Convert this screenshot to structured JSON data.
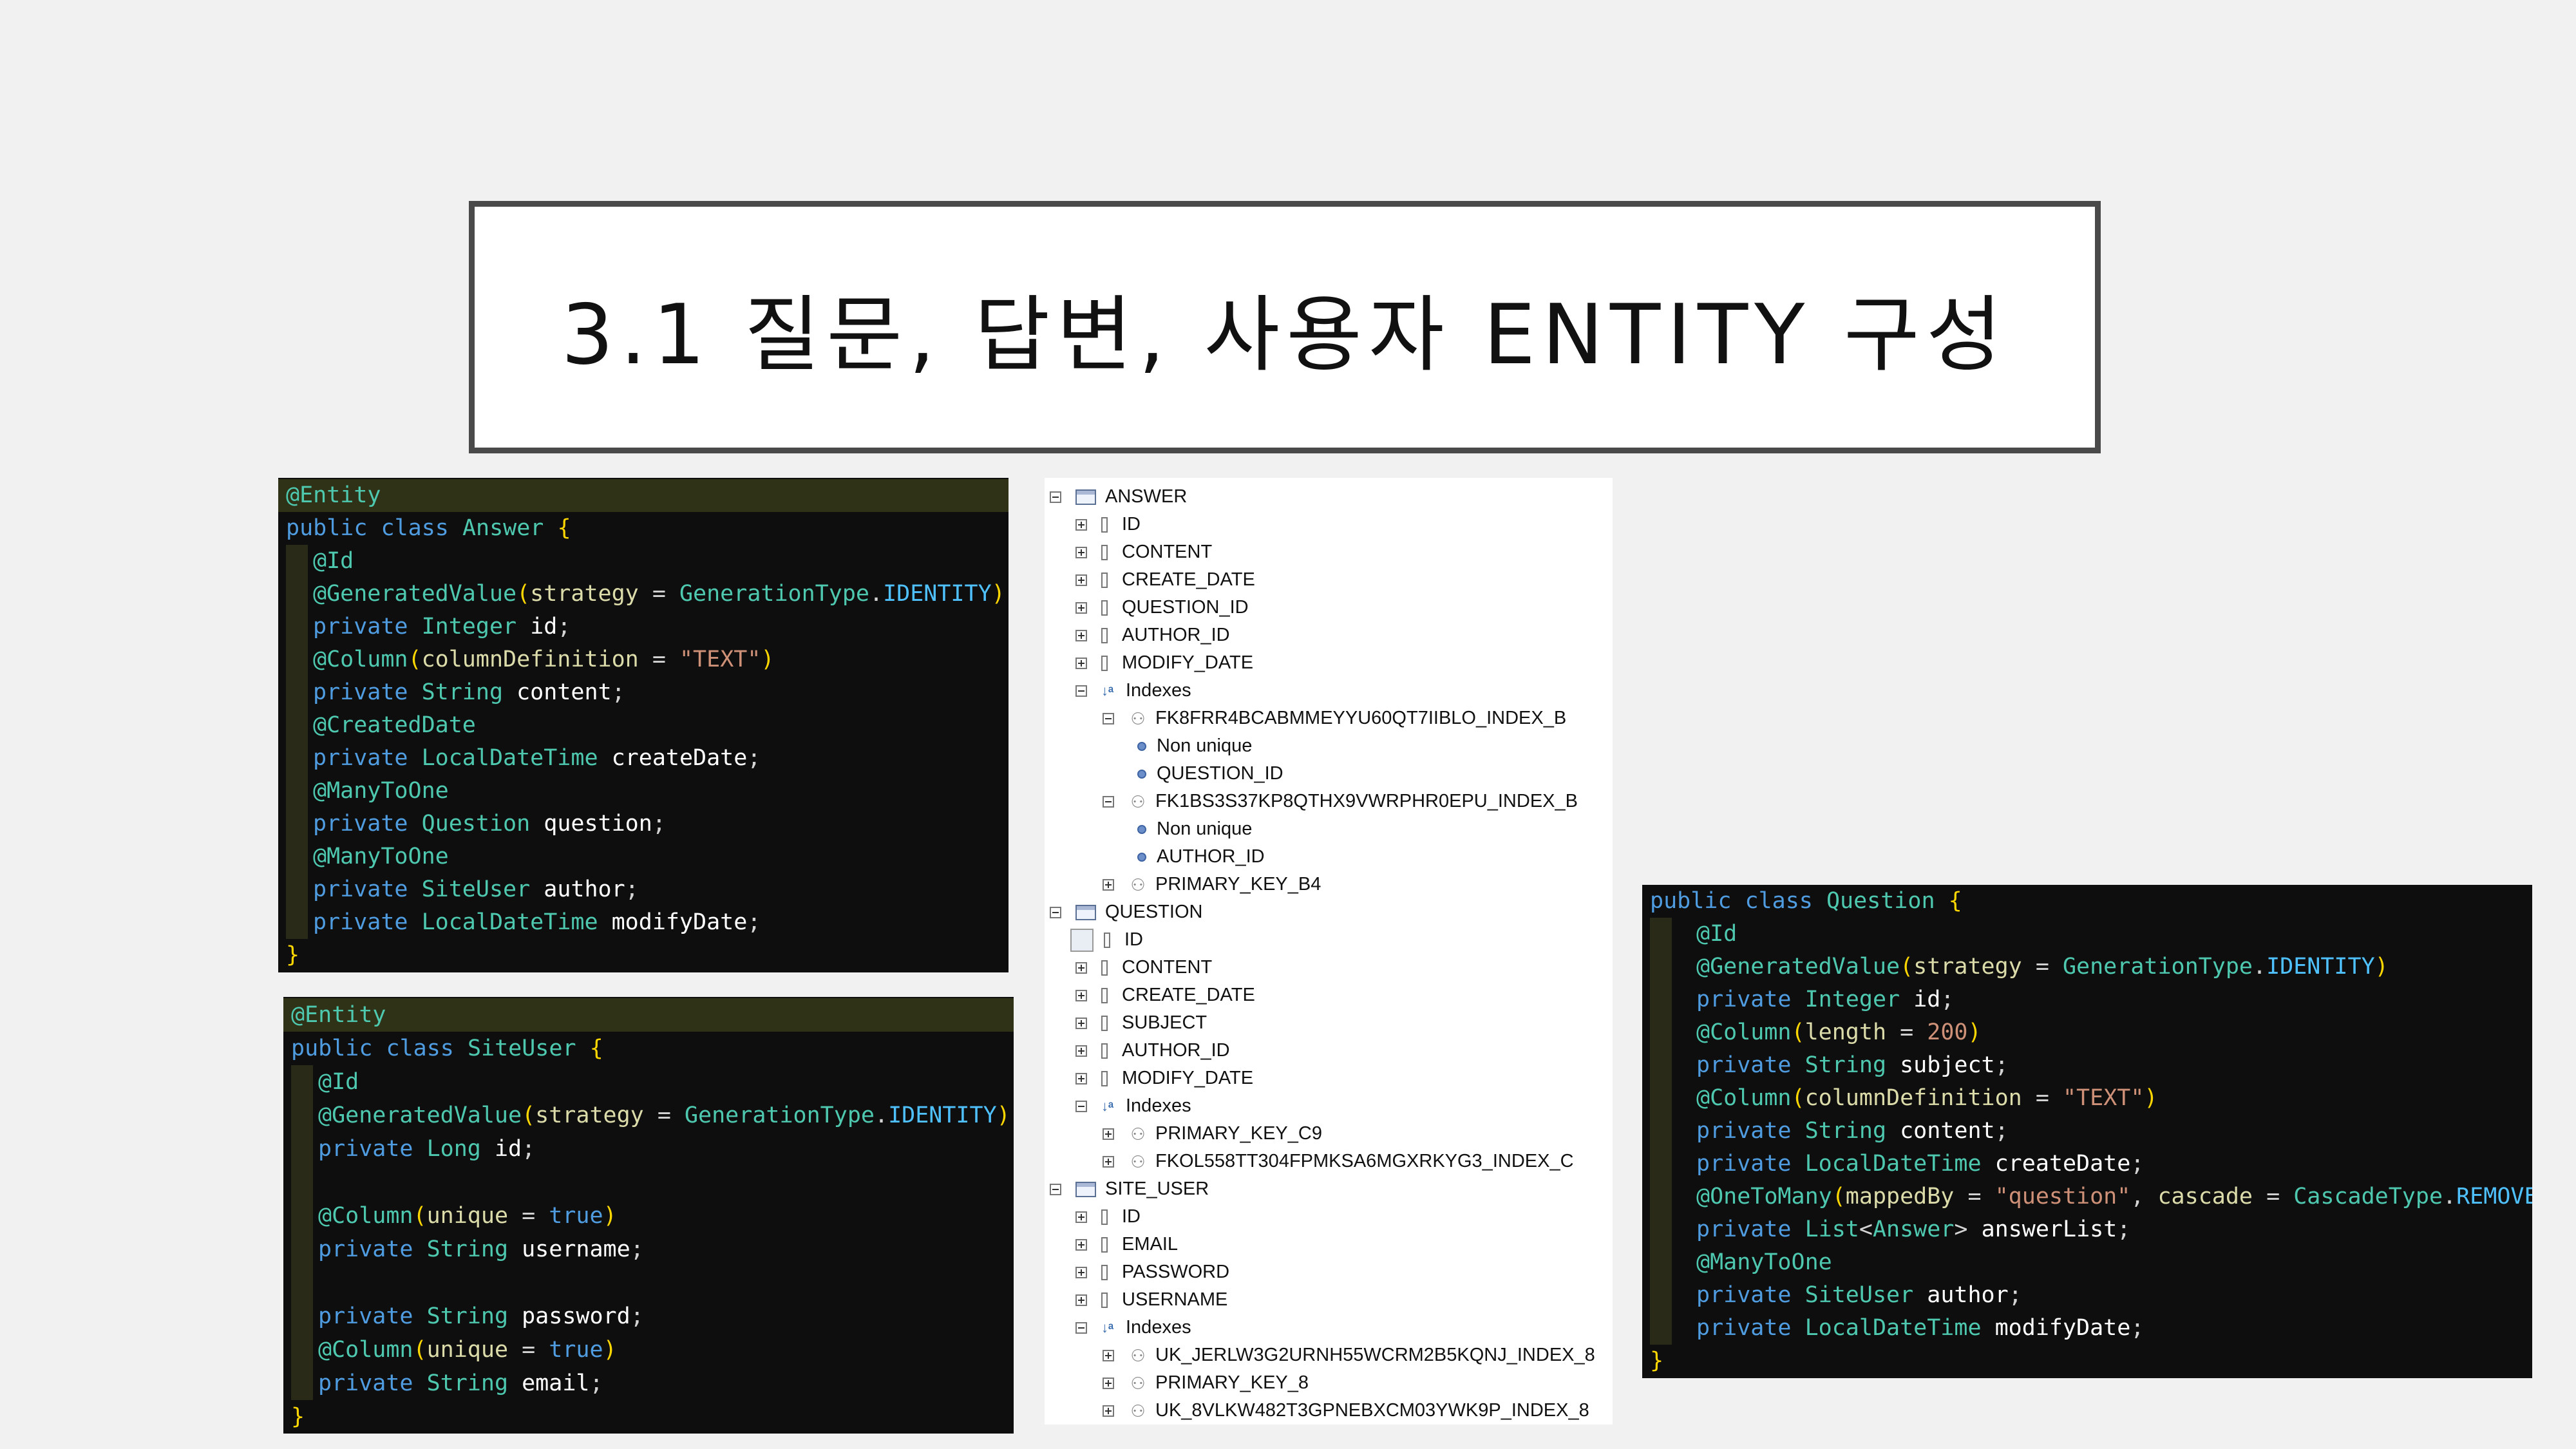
{
  "slide": {
    "title": "3.1 질문, 답변, 사용자 ENTITY 구성"
  },
  "answer_code": {
    "l1": "@Entity",
    "l2_kw": "public class",
    "l2_cls": "Answer",
    "l3": "@Id",
    "l4_ann": "@GeneratedValue",
    "l4_arg": "strategy",
    "l4_type": "GenerationType",
    "l4_const": "IDENTITY",
    "l5_kw": "private",
    "l5_type": "Integer",
    "l5_var": "id",
    "l6_ann": "@Column",
    "l6_arg": "columnDefinition",
    "l6_str": "\"TEXT\"",
    "l7_type": "String",
    "l7_var": "content",
    "l8": "@CreatedDate",
    "l9_type": "LocalDateTime",
    "l9_var": "createDate",
    "l10": "@ManyToOne",
    "l11_type": "Question",
    "l11_var": "question",
    "l12": "@ManyToOne",
    "l13_type": "SiteUser",
    "l13_var": "author",
    "l14_type": "LocalDateTime",
    "l14_var": "modifyDate"
  },
  "siteuser_code": {
    "l1": "@Entity",
    "l2_kw": "public class",
    "l2_cls": "SiteUser",
    "l3": "@Id",
    "l4_ann": "@GeneratedValue",
    "l4_arg": "strategy",
    "l4_type": "GenerationType",
    "l4_const": "IDENTITY",
    "l5_kw": "private",
    "l5_type": "Long",
    "l5_var": "id",
    "l7_ann": "@Column",
    "l7_arg": "unique",
    "l7_val": "true",
    "l8_type": "String",
    "l8_var": "username",
    "l10_type": "String",
    "l10_var": "password",
    "l11_ann": "@Column",
    "l11_arg": "unique",
    "l11_val": "true",
    "l12_type": "String",
    "l12_var": "email"
  },
  "question_code": {
    "l1_kw": "public class",
    "l1_cls": "Question",
    "l2": "@Id",
    "l3_ann": "@GeneratedValue",
    "l3_arg": "strategy",
    "l3_type": "GenerationType",
    "l3_const": "IDENTITY",
    "l4_kw": "private",
    "l4_type": "Integer",
    "l4_var": "id",
    "l5_ann": "@Column",
    "l5_arg": "length",
    "l5_val": "200",
    "l6_type": "String",
    "l6_var": "subject",
    "l7_ann": "@Column",
    "l7_arg": "columnDefinition",
    "l7_str": "\"TEXT\"",
    "l8_type": "String",
    "l8_var": "content",
    "l9_type": "LocalDateTime",
    "l9_var": "createDate",
    "l10_ann": "@OneToMany",
    "l10_arg1": "mappedBy",
    "l10_str": "\"question\"",
    "l10_arg2": "cascade",
    "l10_type": "CascadeType",
    "l10_const": "REMOVE",
    "l11_type": "List",
    "l11_gen": "Answer",
    "l11_var": "answerList",
    "l12": "@ManyToOne",
    "l13_type": "SiteUser",
    "l13_var": "author",
    "l14_type": "LocalDateTime",
    "l14_var": "modifyDate"
  },
  "tree": {
    "answer": {
      "table": "ANSWER",
      "cols": [
        "ID",
        "CONTENT",
        "CREATE_DATE",
        "QUESTION_ID",
        "AUTHOR_ID",
        "MODIFY_DATE"
      ],
      "indexes": "Indexes",
      "idx1": "FK8FRR4BCABMMEYYU60QT7IIBLO_INDEX_B",
      "idx1_a": "Non unique",
      "idx1_b": "QUESTION_ID",
      "idx2": "FK1BS3S37KP8QTHX9VWRPHR0EPU_INDEX_B",
      "idx2_a": "Non unique",
      "idx2_b": "AUTHOR_ID",
      "idx3": "PRIMARY_KEY_B4"
    },
    "question": {
      "table": "QUESTION",
      "cols": [
        "ID",
        "CONTENT",
        "CREATE_DATE",
        "SUBJECT",
        "AUTHOR_ID",
        "MODIFY_DATE"
      ],
      "indexes": "Indexes",
      "idx1": "PRIMARY_KEY_C9",
      "idx2": "FKOL558TT304FPMKSA6MGXRKYG3_INDEX_C"
    },
    "site_user": {
      "table": "SITE_USER",
      "cols": [
        "ID",
        "EMAIL",
        "PASSWORD",
        "USERNAME"
      ],
      "indexes": "Indexes",
      "idx1": "UK_JERLW3G2URNH55WCRM2B5KQNJ_INDEX_8",
      "idx2": "PRIMARY_KEY_8",
      "idx3": "UK_8VLKW482T3GPNEBXCM03YWK9P_INDEX_8"
    }
  }
}
